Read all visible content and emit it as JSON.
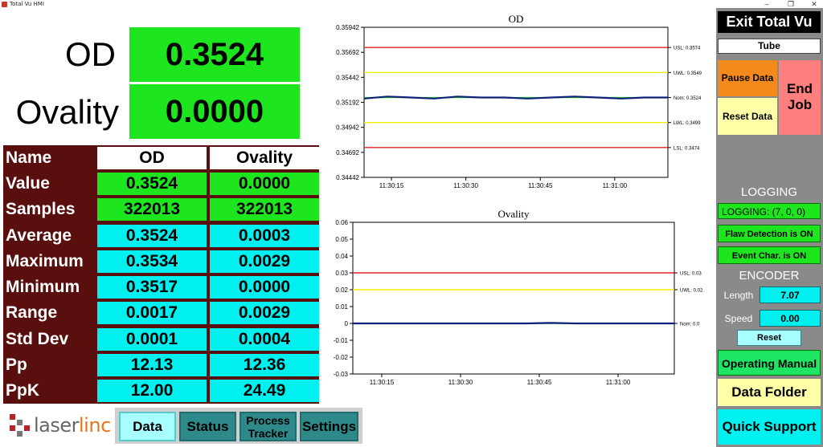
{
  "window": {
    "title": "Total Vu HMI",
    "minimize": "–",
    "restore": "❐",
    "close": "✕"
  },
  "main": {
    "od_label": "OD",
    "od_value": "0.3524",
    "ovality_label": "Ovality",
    "ovality_value": "0.0000"
  },
  "stats": {
    "header": {
      "name": "Name",
      "col1": "OD",
      "col2": "Ovality"
    },
    "rows": [
      {
        "name": "Value",
        "od": "0.3524",
        "ovality": "0.0000"
      },
      {
        "name": "Samples",
        "od": "322013",
        "ovality": "322013"
      },
      {
        "name": "Average",
        "od": "0.3524",
        "ovality": "0.0003"
      },
      {
        "name": "Maximum",
        "od": "0.3534",
        "ovality": "0.0029"
      },
      {
        "name": "Minimum",
        "od": "0.3517",
        "ovality": "0.0000"
      },
      {
        "name": "Range",
        "od": "0.0017",
        "ovality": "0.0029"
      },
      {
        "name": "Std Dev",
        "od": "0.0001",
        "ovality": "0.0004"
      },
      {
        "name": "Pp",
        "od": "12.13",
        "ovality": "12.36"
      },
      {
        "name": "PpK",
        "od": "12.00",
        "ovality": "24.49"
      }
    ]
  },
  "logo": {
    "part1": "laser",
    "part2": "linc"
  },
  "nav": {
    "data": "Data",
    "status": "Status",
    "process_line1": "Process",
    "process_line2": "Tracker",
    "settings": "Settings"
  },
  "chart_data": [
    {
      "type": "line",
      "title": "OD",
      "x": [
        "11:30:15",
        "11:30:30",
        "11:30:45",
        "11:31:00"
      ],
      "ylim": [
        0.34442,
        0.35942
      ],
      "yticks": [
        "0.35942",
        "0.35692",
        "0.35442",
        "0.35192",
        "0.34942",
        "0.34692",
        "0.34442"
      ],
      "limits": [
        {
          "label": "USL: 0.3574",
          "value": 0.3574,
          "color": "#e02020"
        },
        {
          "label": "UWL: 0.3549",
          "value": 0.3549,
          "color": "#f0f000"
        },
        {
          "label": "Nom: 0.3524",
          "value": 0.3524,
          "color": "#1ee61e"
        },
        {
          "label": "LWL: 0.3499",
          "value": 0.3499,
          "color": "#f0f000"
        },
        {
          "label": "LSL: 0.3474",
          "value": 0.3474,
          "color": "#e02020"
        }
      ],
      "series": [
        {
          "values": [
            0.3523,
            0.3525,
            0.3524,
            0.3523,
            0.3525,
            0.3524,
            0.3524,
            0.3523,
            0.3524,
            0.3525,
            0.3524,
            0.3523,
            0.3524,
            0.3524
          ],
          "color": "#10207a"
        }
      ]
    },
    {
      "type": "line",
      "title": "Ovality",
      "x": [
        "11:30:15",
        "11:30:30",
        "11:30:45",
        "11:31:00"
      ],
      "ylim": [
        -0.03,
        0.06
      ],
      "yticks": [
        "0.06",
        "0.05",
        "0.04",
        "0.03",
        "0.02",
        "0.01",
        "0",
        "-0.01",
        "-0.02",
        "-0.03"
      ],
      "limits": [
        {
          "label": "USL: 0.03",
          "value": 0.03,
          "color": "#e02020"
        },
        {
          "label": "UWL: 0.02",
          "value": 0.02,
          "color": "#f0f000"
        },
        {
          "label": "Nom: 0.0",
          "value": 0.0,
          "color": "#1ee61e"
        }
      ],
      "series": [
        {
          "values": [
            0.0,
            0.0,
            0.0,
            0.0,
            0.0,
            0.0,
            0.0,
            0.0,
            0.0003,
            0.0,
            0.0,
            0.0,
            0.0,
            0.0
          ],
          "color": "#10207a"
        }
      ]
    }
  ],
  "side": {
    "exit": "Exit Total Vu",
    "tube": "Tube",
    "pause": "Pause Data",
    "reset_data": "Reset Data",
    "end_line1": "End",
    "end_line2": "Job",
    "logging_title": "LOGGING",
    "logging_status": "LOGGING: (7, 0, 0)",
    "flaw": "Flaw Detection is ON",
    "event": "Event Char. is ON",
    "encoder_title": "ENCODER",
    "length_label": "Length",
    "length_value": "7.07",
    "speed_label": "Speed",
    "speed_value": "0.00",
    "reset": "Reset",
    "manual": "Operating Manual",
    "folder": "Data Folder",
    "support": "Quick Support"
  }
}
